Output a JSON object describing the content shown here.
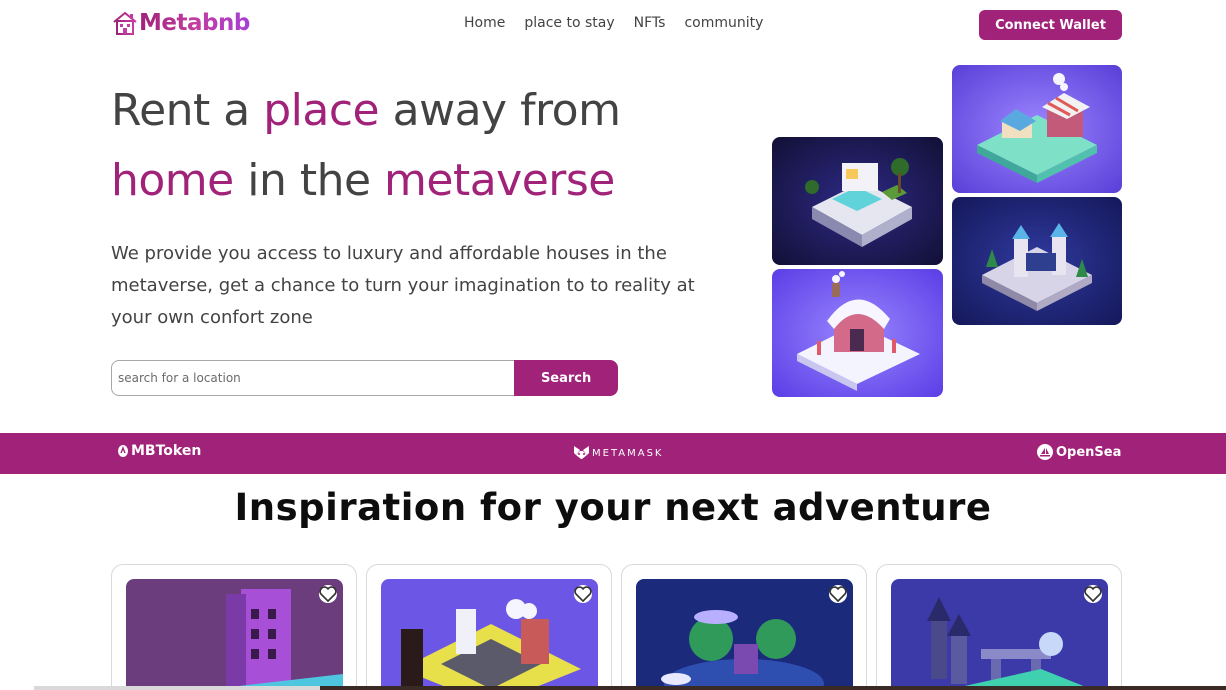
{
  "brand": {
    "name": "Metabnb",
    "accent": "#a02279",
    "icon": "house-icon"
  },
  "nav": {
    "links": [
      "Home",
      "place to stay",
      "NFTs",
      "community"
    ],
    "connect_label": "Connect Wallet"
  },
  "hero": {
    "title_parts": [
      "Rent a ",
      "place",
      " away from",
      "home",
      " in the ",
      "metaverse"
    ],
    "description": "We provide you access to luxury and affordable houses in the metaverse, get a chance to turn your imagination to to reality at your own confort zone",
    "search_placeholder": "search for a location",
    "search_button": "Search"
  },
  "gallery": [
    {
      "name": "villa-pool-tile",
      "bg": "#1f1d5c"
    },
    {
      "name": "market-stall-tile",
      "bg": "#8a6cf0"
    },
    {
      "name": "snow-cottage-tile",
      "bg": "#7b5ef2"
    },
    {
      "name": "castle-tile",
      "bg": "#2a2e86"
    }
  ],
  "partners": {
    "mbtoken": "MBToken",
    "metamask": "METAMASK",
    "opensea": "OpenSea"
  },
  "inspiration": {
    "title": "Inspiration for your next adventure",
    "cards": [
      {
        "name": "card-tower",
        "bg": "#6b3d7c"
      },
      {
        "name": "card-city",
        "bg": "#6c56e6"
      },
      {
        "name": "card-island",
        "bg": "#1b2a7a"
      },
      {
        "name": "card-castle-night",
        "bg": "#3b3aa8"
      }
    ]
  }
}
